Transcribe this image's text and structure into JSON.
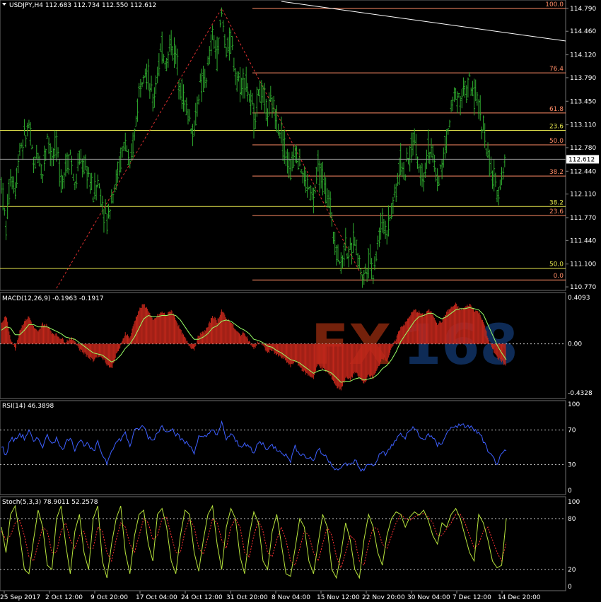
{
  "title": "USDJPY,H4  112.683 112.734 112.550 112.612",
  "watermark": {
    "part1": "FX",
    "part2": "168",
    "color1": "#ff4a1a",
    "color2": "#1f5fbf"
  },
  "colors": {
    "candle": "#2ea92e",
    "grid": "#4d4d4d",
    "fibo_red": "#ff8c66",
    "fibo_yellow": "#e5e54d",
    "macd_hist": "#c1271b",
    "macd_signal": "#99ff66",
    "rsi_line": "#3d5fff",
    "stoch_main": "#b8e53d",
    "stoch_signal": "#ff3333",
    "level_dash": "#c8c8c8"
  },
  "chart_data": [
    {
      "type": "candlestick",
      "symbol": "USDJPY",
      "timeframe": "H4",
      "ohlc_last": {
        "open": 112.683,
        "high": 112.734,
        "low": 112.55,
        "close": 112.612
      },
      "current_price": "112.612",
      "ylim": [
        110.75,
        114.85
      ],
      "y_ticks": [
        "114.790",
        "114.460",
        "114.120",
        "113.790",
        "113.450",
        "113.110",
        "112.780",
        "112.440",
        "112.110",
        "111.770",
        "111.440",
        "111.100",
        "110.770"
      ],
      "x_ticks": [
        "25 Sep 2017",
        "2 Oct 12:00",
        "9 Oct 20:00",
        "17 Oct 04:00",
        "24 Oct 12:00",
        "31 Oct 20:00",
        "8 Nov 04:00",
        "15 Nov 12:00",
        "22 Nov 20:00",
        "30 Nov 04:00",
        "7 Dec 12:00",
        "14 Dec 20:00"
      ],
      "close_path": [
        [
          0,
          112.3
        ],
        [
          1,
          111.6
        ],
        [
          2,
          112.4
        ],
        [
          3,
          112.2
        ],
        [
          4,
          112.8
        ],
        [
          5,
          112.9
        ],
        [
          6,
          113.1
        ],
        [
          7,
          112.5
        ],
        [
          8,
          112.7
        ],
        [
          9,
          112.4
        ],
        [
          10,
          113.0
        ],
        [
          11,
          112.6
        ],
        [
          12,
          112.8
        ],
        [
          13,
          112.3
        ],
        [
          14,
          112.5
        ],
        [
          15,
          112.7
        ],
        [
          16,
          112.2
        ],
        [
          17,
          112.6
        ],
        [
          18,
          112.5
        ],
        [
          19,
          112.4
        ],
        [
          20,
          112.1
        ],
        [
          21,
          112.3
        ],
        [
          22,
          112.0
        ],
        [
          23,
          111.7
        ],
        [
          24,
          112.1
        ],
        [
          25,
          112.3
        ],
        [
          26,
          112.6
        ],
        [
          27,
          112.9
        ],
        [
          28,
          112.4
        ],
        [
          29,
          113.0
        ],
        [
          30,
          113.6
        ],
        [
          31,
          114.0
        ],
        [
          32,
          113.8
        ],
        [
          33,
          113.4
        ],
        [
          34,
          113.9
        ],
        [
          35,
          114.2
        ],
        [
          36,
          114.0
        ],
        [
          37,
          114.3
        ],
        [
          38,
          114.1
        ],
        [
          39,
          113.7
        ],
        [
          40,
          113.4
        ],
        [
          41,
          113.2
        ],
        [
          42,
          113.0
        ],
        [
          43,
          113.6
        ],
        [
          44,
          113.7
        ],
        [
          45,
          113.9
        ],
        [
          46,
          114.4
        ],
        [
          47,
          114.1
        ],
        [
          48,
          114.7
        ],
        [
          49,
          114.2
        ],
        [
          50,
          114.3
        ],
        [
          51,
          113.9
        ],
        [
          52,
          113.7
        ],
        [
          53,
          113.8
        ],
        [
          54,
          113.5
        ],
        [
          55,
          113.2
        ],
        [
          56,
          113.6
        ],
        [
          57,
          113.5
        ],
        [
          58,
          113.3
        ],
        [
          59,
          113.4
        ],
        [
          60,
          113.2
        ],
        [
          61,
          113.0
        ],
        [
          62,
          112.7
        ],
        [
          63,
          112.4
        ],
        [
          64,
          112.8
        ],
        [
          65,
          112.6
        ],
        [
          66,
          112.3
        ],
        [
          67,
          112.2
        ],
        [
          68,
          112.0
        ],
        [
          69,
          112.5
        ],
        [
          70,
          112.3
        ],
        [
          71,
          112.1
        ],
        [
          72,
          111.8
        ],
        [
          73,
          111.3
        ],
        [
          74,
          111.1
        ],
        [
          75,
          111.4
        ],
        [
          76,
          111.2
        ],
        [
          77,
          111.5
        ],
        [
          78,
          111.1
        ],
        [
          79,
          110.9
        ],
        [
          80,
          111.2
        ],
        [
          81,
          111.0
        ],
        [
          82,
          111.4
        ],
        [
          83,
          111.7
        ],
        [
          84,
          111.6
        ],
        [
          85,
          111.9
        ],
        [
          86,
          112.2
        ],
        [
          87,
          112.6
        ],
        [
          88,
          112.4
        ],
        [
          89,
          112.7
        ],
        [
          90,
          112.9
        ],
        [
          91,
          112.5
        ],
        [
          92,
          112.4
        ],
        [
          93,
          112.8
        ],
        [
          94,
          112.6
        ],
        [
          95,
          112.3
        ],
        [
          96,
          112.5
        ],
        [
          97,
          112.9
        ],
        [
          98,
          113.3
        ],
        [
          99,
          113.6
        ],
        [
          100,
          113.5
        ],
        [
          101,
          113.6
        ],
        [
          102,
          113.7
        ],
        [
          103,
          113.5
        ],
        [
          104,
          113.4
        ],
        [
          105,
          113.1
        ],
        [
          106,
          112.6
        ],
        [
          107,
          112.4
        ],
        [
          108,
          112.1
        ],
        [
          109,
          112.4
        ],
        [
          110,
          112.61
        ]
      ],
      "line_high": 114.79,
      "line_low": 110.87,
      "bar_index_range": [
        0,
        110
      ],
      "fibo_sets": [
        {
          "color_key": "fibo_red",
          "levels": [
            {
              "label": "100.0",
              "price": 114.79
            },
            {
              "label": "76.4",
              "price": 113.86
            },
            {
              "label": "61.8",
              "price": 113.28
            },
            {
              "label": "50.0",
              "price": 112.82
            },
            {
              "label": "38.2",
              "price": 112.37
            },
            {
              "label": "23.6",
              "price": 111.8
            },
            {
              "label": "0.0",
              "price": 110.87
            }
          ]
        },
        {
          "color_key": "fibo_yellow",
          "levels": [
            {
              "label": "23.6",
              "price": 113.03
            },
            {
              "label": "38.2",
              "price": 111.93
            },
            {
              "label": "50.0",
              "price": 111.04
            }
          ]
        }
      ]
    },
    {
      "type": "macd",
      "label": "MACD(12,26,9) -0.1963 -0.1917",
      "ylim": [
        -0.4328,
        0.4093
      ],
      "y_ticks": [
        "0.4093",
        "0.00",
        "-0.4328"
      ],
      "hist": [
        0.18,
        0.25,
        0.05,
        -0.05,
        0.12,
        0.2,
        0.24,
        0.15,
        0.1,
        0.18,
        0.16,
        0.1,
        0.08,
        0.05,
        0.02,
        0.05,
        0.03,
        -0.05,
        -0.08,
        -0.12,
        -0.15,
        -0.1,
        -0.12,
        -0.18,
        -0.22,
        -0.1,
        -0.02,
        0.1,
        0.05,
        0.2,
        0.3,
        0.35,
        0.3,
        0.2,
        0.25,
        0.28,
        0.25,
        0.3,
        0.22,
        0.12,
        0.05,
        -0.02,
        -0.05,
        0.08,
        0.1,
        0.15,
        0.25,
        0.2,
        0.3,
        0.22,
        0.2,
        0.12,
        0.08,
        0.1,
        0.02,
        -0.05,
        0.02,
        -0.02,
        -0.08,
        -0.05,
        -0.1,
        -0.12,
        -0.15,
        -0.2,
        -0.15,
        -0.2,
        -0.25,
        -0.28,
        -0.3,
        -0.18,
        -0.22,
        -0.25,
        -0.3,
        -0.38,
        -0.4,
        -0.3,
        -0.32,
        -0.25,
        -0.3,
        -0.35,
        -0.28,
        -0.3,
        -0.22,
        -0.12,
        -0.15,
        -0.05,
        0.05,
        0.15,
        0.18,
        0.25,
        0.3,
        0.28,
        0.25,
        0.3,
        0.26,
        0.18,
        0.2,
        0.28,
        0.32,
        0.35,
        0.3,
        0.32,
        0.35,
        0.3,
        0.28,
        0.2,
        0.05,
        -0.05,
        -0.12,
        -0.15,
        -0.2
      ],
      "signal": [
        0.12,
        0.15,
        0.14,
        0.08,
        0.08,
        0.12,
        0.17,
        0.17,
        0.15,
        0.15,
        0.15,
        0.13,
        0.11,
        0.09,
        0.06,
        0.05,
        0.04,
        0.01,
        -0.02,
        -0.05,
        -0.08,
        -0.09,
        -0.1,
        -0.13,
        -0.16,
        -0.14,
        -0.1,
        -0.04,
        0.0,
        0.06,
        0.14,
        0.22,
        0.25,
        0.24,
        0.24,
        0.25,
        0.25,
        0.26,
        0.25,
        0.21,
        0.15,
        0.09,
        0.04,
        0.04,
        0.06,
        0.09,
        0.14,
        0.16,
        0.2,
        0.21,
        0.2,
        0.17,
        0.14,
        0.12,
        0.09,
        0.04,
        0.03,
        0.01,
        -0.02,
        -0.03,
        -0.06,
        -0.08,
        -0.11,
        -0.14,
        -0.15,
        -0.17,
        -0.2,
        -0.23,
        -0.26,
        -0.24,
        -0.23,
        -0.24,
        -0.26,
        -0.3,
        -0.34,
        -0.33,
        -0.33,
        -0.31,
        -0.3,
        -0.32,
        -0.31,
        -0.3,
        -0.27,
        -0.22,
        -0.19,
        -0.14,
        -0.07,
        0.02,
        0.08,
        0.14,
        0.2,
        0.24,
        0.25,
        0.27,
        0.27,
        0.24,
        0.22,
        0.24,
        0.27,
        0.3,
        0.31,
        0.31,
        0.32,
        0.31,
        0.3,
        0.26,
        0.17,
        0.08,
        -0.01,
        -0.08,
        -0.14
      ]
    },
    {
      "type": "line",
      "label": "RSI(14) 46.3898",
      "ylim": [
        0,
        100
      ],
      "y_ticks": [
        "100",
        "70",
        "30",
        "0"
      ],
      "levels": [
        70,
        30
      ],
      "values": [
        52,
        40,
        60,
        58,
        66,
        60,
        70,
        55,
        60,
        52,
        63,
        56,
        60,
        48,
        54,
        63,
        48,
        58,
        54,
        52,
        44,
        55,
        42,
        32,
        48,
        55,
        60,
        66,
        52,
        68,
        72,
        74,
        62,
        58,
        68,
        74,
        70,
        72,
        66,
        60,
        56,
        52,
        45,
        62,
        60,
        64,
        73,
        62,
        78,
        60,
        65,
        58,
        50,
        56,
        50,
        42,
        56,
        54,
        48,
        52,
        48,
        46,
        40,
        35,
        50,
        44,
        40,
        38,
        35,
        48,
        42,
        38,
        30,
        25,
        24,
        32,
        28,
        36,
        26,
        22,
        32,
        28,
        38,
        45,
        42,
        52,
        58,
        66,
        60,
        70,
        74,
        62,
        58,
        66,
        60,
        52,
        56,
        66,
        72,
        76,
        74,
        75,
        74,
        70,
        66,
        58,
        44,
        38,
        32,
        40,
        46
      ]
    },
    {
      "type": "line",
      "label": "Stoch(5,3,3) 78.9011 52.2578",
      "ylim": [
        0,
        100
      ],
      "y_ticks": [
        "100",
        "80",
        "20",
        "0"
      ],
      "levels": [
        80,
        20
      ],
      "main": [
        70,
        40,
        85,
        95,
        60,
        20,
        15,
        55,
        90,
        70,
        25,
        20,
        80,
        95,
        50,
        15,
        65,
        85,
        40,
        20,
        80,
        95,
        30,
        10,
        50,
        80,
        95,
        40,
        15,
        60,
        85,
        90,
        50,
        30,
        85,
        92,
        70,
        30,
        15,
        60,
        90,
        85,
        40,
        18,
        55,
        85,
        95,
        50,
        20,
        70,
        92,
        80,
        35,
        15,
        60,
        88,
        75,
        30,
        20,
        65,
        85,
        50,
        15,
        12,
        45,
        80,
        70,
        30,
        15,
        50,
        85,
        70,
        20,
        10,
        40,
        75,
        55,
        20,
        10,
        55,
        85,
        70,
        40,
        25,
        60,
        80,
        88,
        85,
        70,
        82,
        88,
        84,
        90,
        78,
        60,
        50,
        75,
        70,
        85,
        92,
        80,
        60,
        40,
        30,
        85,
        75,
        55,
        30,
        22,
        25,
        80
      ],
      "signal": [
        65,
        55,
        60,
        75,
        78,
        60,
        35,
        30,
        50,
        70,
        65,
        40,
        40,
        65,
        75,
        55,
        45,
        60,
        65,
        45,
        45,
        70,
        65,
        40,
        30,
        55,
        75,
        70,
        50,
        40,
        60,
        80,
        75,
        55,
        60,
        80,
        82,
        60,
        40,
        40,
        65,
        80,
        70,
        45,
        38,
        58,
        80,
        75,
        55,
        45,
        70,
        80,
        70,
        40,
        35,
        60,
        78,
        65,
        40,
        35,
        55,
        70,
        55,
        30,
        25,
        45,
        65,
        60,
        40,
        30,
        50,
        70,
        60,
        35,
        22,
        40,
        60,
        55,
        30,
        25,
        50,
        70,
        68,
        50,
        45,
        60,
        75,
        85,
        80,
        78,
        82,
        85,
        86,
        82,
        75,
        60,
        60,
        68,
        75,
        85,
        85,
        75,
        60,
        45,
        50,
        65,
        70,
        55,
        40,
        30,
        52
      ]
    }
  ]
}
